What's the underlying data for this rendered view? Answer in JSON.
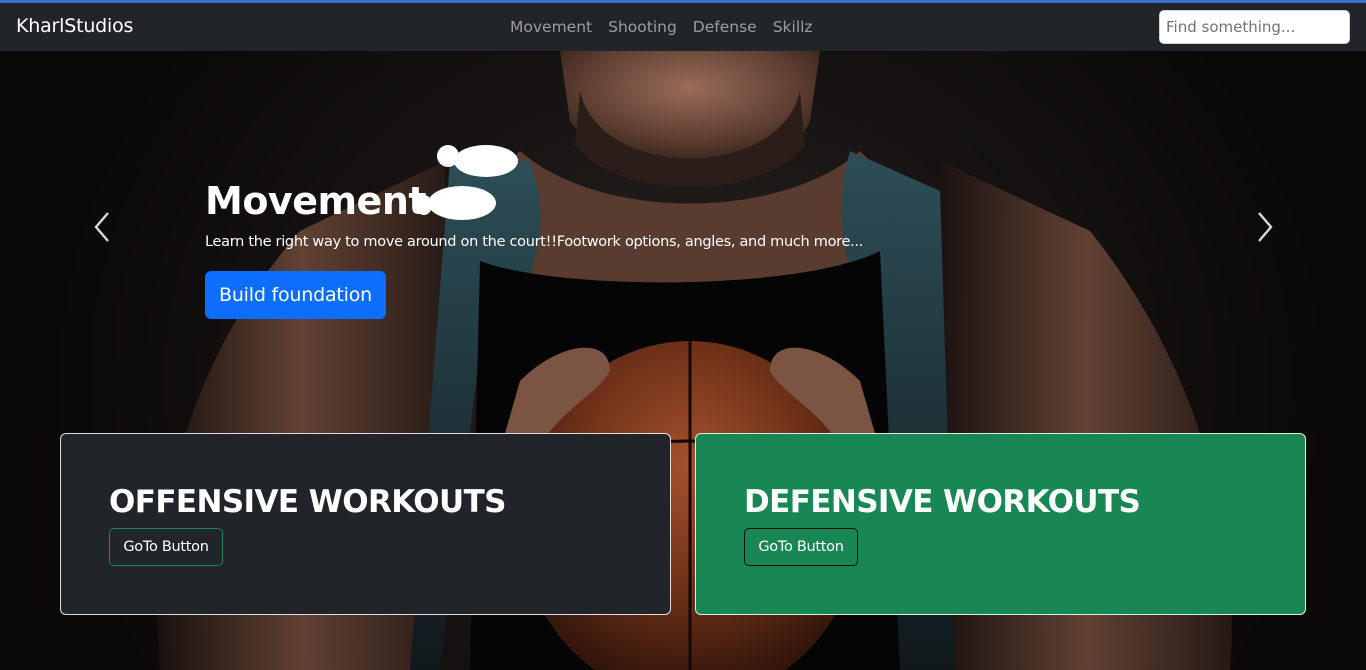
{
  "navbar": {
    "brand": "KharlStudios",
    "links": [
      "Movement",
      "Shooting",
      "Defense",
      "Skillz"
    ],
    "search_placeholder": "Find something..."
  },
  "carousel": {
    "title": "Movement",
    "icon": "footprints-icon",
    "text": "Learn the right way to move around on the court!!Footwork options, angles, and much more...",
    "button_label": "Build foundation"
  },
  "cards": [
    {
      "title": "OFFENSIVE WORKOUTS",
      "button_label": "GoTo Button",
      "color": "#212529"
    },
    {
      "title": "DEFENSIVE WORKOUTS",
      "button_label": "GoTo Button",
      "color": "#198754"
    }
  ],
  "colors": {
    "navbar_bg": "#212529",
    "primary": "#0d6efd",
    "success": "#198754",
    "accent_line": "#3b6fd0"
  }
}
